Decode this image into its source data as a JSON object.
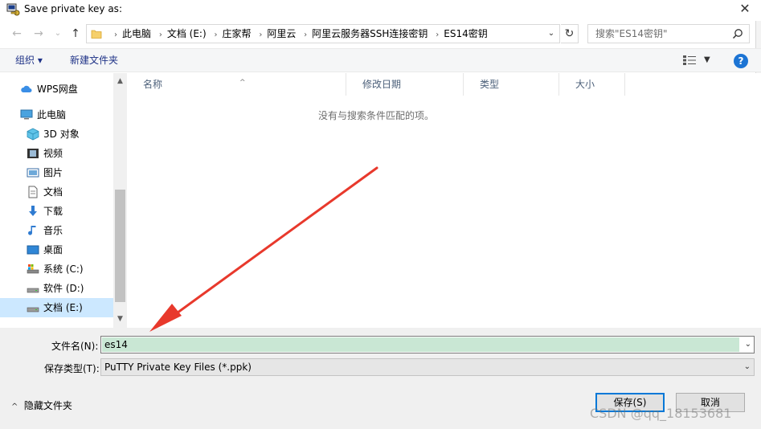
{
  "window": {
    "title": "Save private key as:",
    "close_glyph": "✕"
  },
  "nav": {
    "back_glyph": "←",
    "forward_glyph": "→",
    "recent_glyph": "⌄",
    "up_glyph": "↑",
    "breadcrumbs": [
      "此电脑",
      "文档 (E:)",
      "庄家帮",
      "阿里云",
      "阿里云服务器SSH连接密钥",
      "ES14密钥"
    ],
    "crumb_separator": "›",
    "address_dropdown_glyph": "⌄",
    "refresh_glyph": "↻",
    "search_placeholder": "搜索\"ES14密钥\""
  },
  "toolbar": {
    "organize_label": "组织 ▾",
    "new_folder_label": "新建文件夹",
    "view_dropdown_glyph": "▼",
    "help_glyph": "?"
  },
  "sidebar": {
    "items": [
      {
        "label": "WPS网盘",
        "icon": "cloud-icon"
      },
      {
        "label": "此电脑",
        "icon": "computer-icon"
      },
      {
        "label": "3D 对象",
        "icon": "cube-icon"
      },
      {
        "label": "视频",
        "icon": "video-icon"
      },
      {
        "label": "图片",
        "icon": "picture-icon"
      },
      {
        "label": "文档",
        "icon": "document-icon"
      },
      {
        "label": "下载",
        "icon": "download-icon"
      },
      {
        "label": "音乐",
        "icon": "music-icon"
      },
      {
        "label": "桌面",
        "icon": "desktop-icon"
      },
      {
        "label": "系统 (C:)",
        "icon": "system-drive-icon"
      },
      {
        "label": "软件 (D:)",
        "icon": "drive-icon"
      },
      {
        "label": "文档 (E:)",
        "icon": "drive-icon",
        "selected": true
      }
    ],
    "scroll_up_glyph": "▲",
    "scroll_down_glyph": "▼"
  },
  "filelist": {
    "columns": [
      "名称",
      "修改日期",
      "类型",
      "大小"
    ],
    "sort_glyph": "^",
    "empty_message": "没有与搜索条件匹配的项。"
  },
  "form": {
    "filename_label": "文件名(N):",
    "filename_value": "es14",
    "filetype_label": "保存类型(T):",
    "filetype_value": "PuTTY Private Key Files (*.ppk)",
    "dropdown_glyph": "⌄",
    "hide_folders_label": "隐藏文件夹",
    "hide_folders_glyph": "^",
    "save_label": "保存(S)",
    "cancel_label": "取消"
  },
  "watermark": "CSDN @qq_18153681",
  "colors": {
    "accent": "#0078d7",
    "selection": "#cce8ff",
    "annotation_arrow": "#e8392c",
    "filename_highlight": "#c9e7d4"
  }
}
